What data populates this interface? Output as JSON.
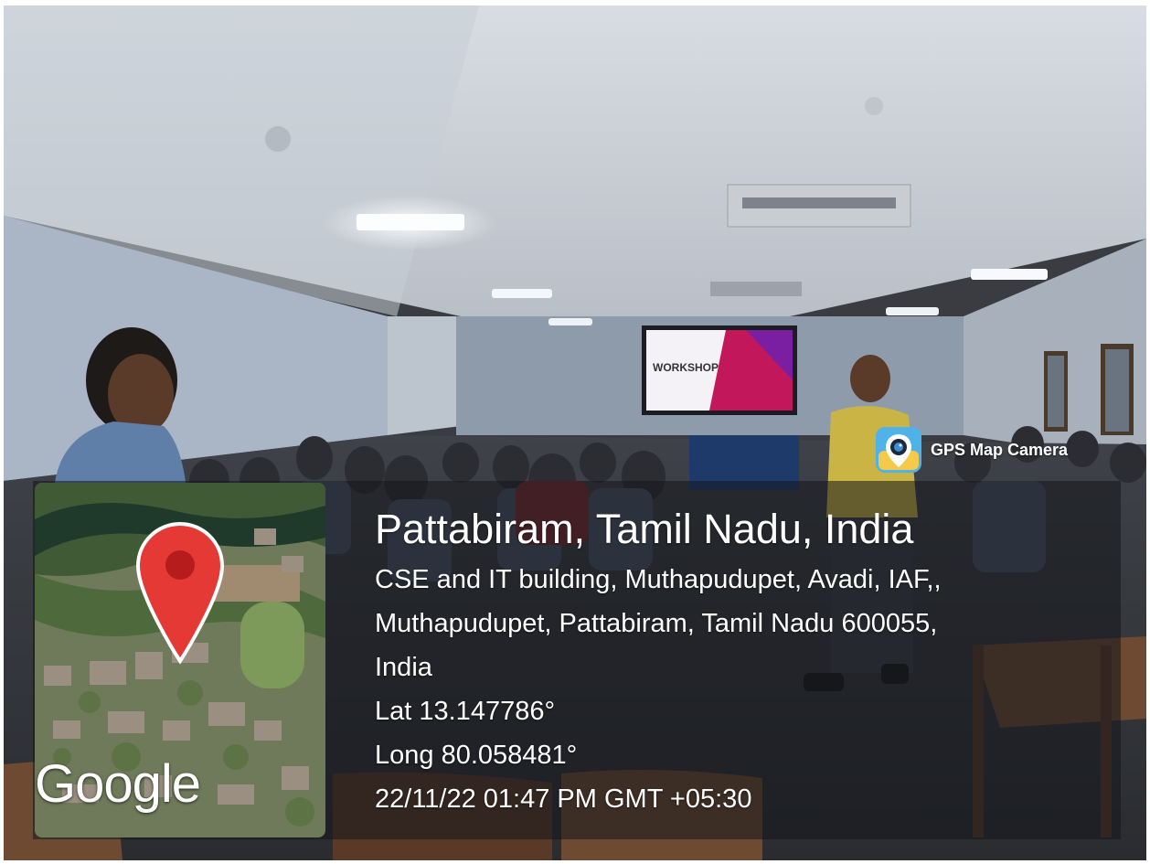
{
  "app": {
    "name": "GPS Map Camera",
    "icon": "gps-map-camera-icon"
  },
  "location": {
    "title": "Pattabiram, Tamil Nadu, India",
    "address_lines": [
      "CSE and IT building, Muthapudupet, Avadi, IAF,,",
      "Muthapudupet, Pattabiram, Tamil Nadu 600055,",
      "India"
    ],
    "latitude": "Lat 13.147786°",
    "longitude": "Long 80.058481°",
    "datetime": "22/11/22 01:47 PM GMT +05:30"
  },
  "map": {
    "provider": "Google",
    "marker_icon": "map-pin-icon"
  },
  "projector_slide": {
    "text": "WORKSHOP"
  },
  "colors": {
    "pin": "#e53935",
    "pin_dot": "#b71c1c",
    "slide_accent": "#c2185b"
  }
}
